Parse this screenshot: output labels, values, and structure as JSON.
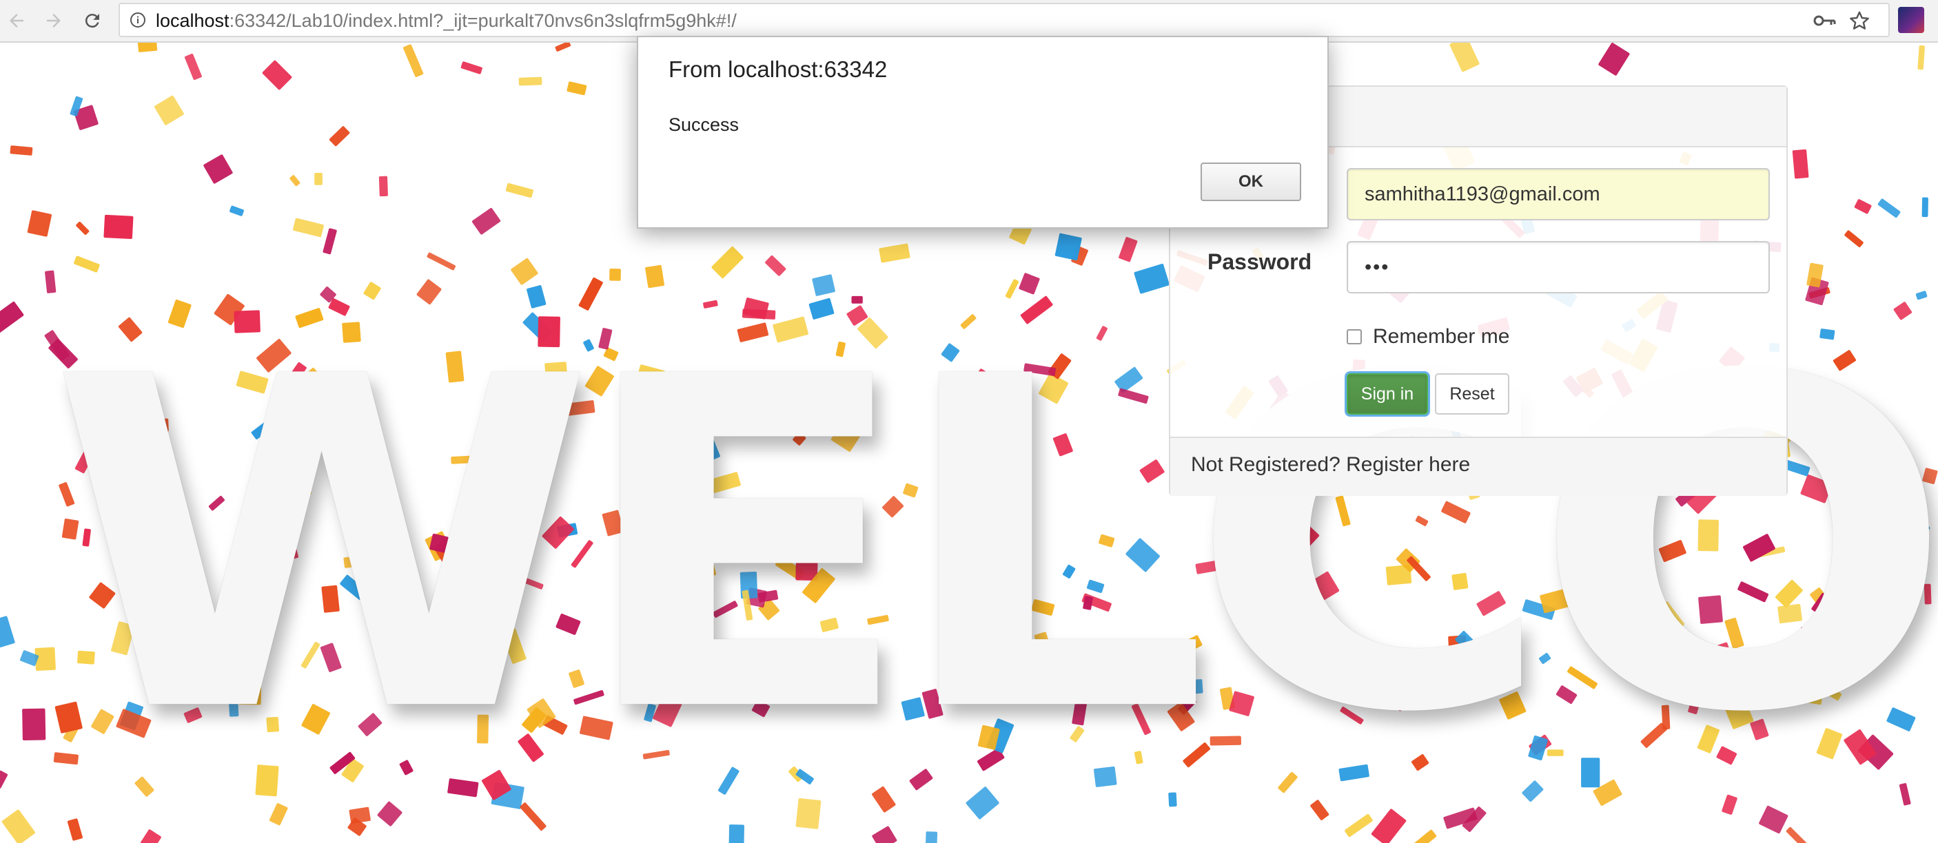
{
  "browser": {
    "url_host": "localhost",
    "url_path": ":63342/Lab10/index.html?_ijt=purkalt70nvs6n3slqfrm5g9hk#!/",
    "icons": [
      "back-icon",
      "forward-icon",
      "reload-icon",
      "info-icon",
      "key-icon",
      "star-icon",
      "extension-icon"
    ]
  },
  "background": {
    "headline": "WELCOME",
    "confetti_colors": [
      "#e8294f",
      "#2a9be0",
      "#f5b21e",
      "#e84a1d",
      "#c2185b",
      "#f7d046"
    ]
  },
  "dialog": {
    "title": "From localhost:63342",
    "message": "Success",
    "ok_label": "OK"
  },
  "login": {
    "email_value": "samhitha1193@gmail.com",
    "password_label": "Password",
    "password_value": "•••",
    "remember_label": "Remember me",
    "remember_checked": false,
    "signin_label": "Sign in",
    "reset_label": "Reset",
    "footer_text": "Not Registered? Register here"
  },
  "colors": {
    "signin_green": "#5cb85c",
    "autofill_yellow": "#fafbd3",
    "panel_border": "#dddddd"
  }
}
